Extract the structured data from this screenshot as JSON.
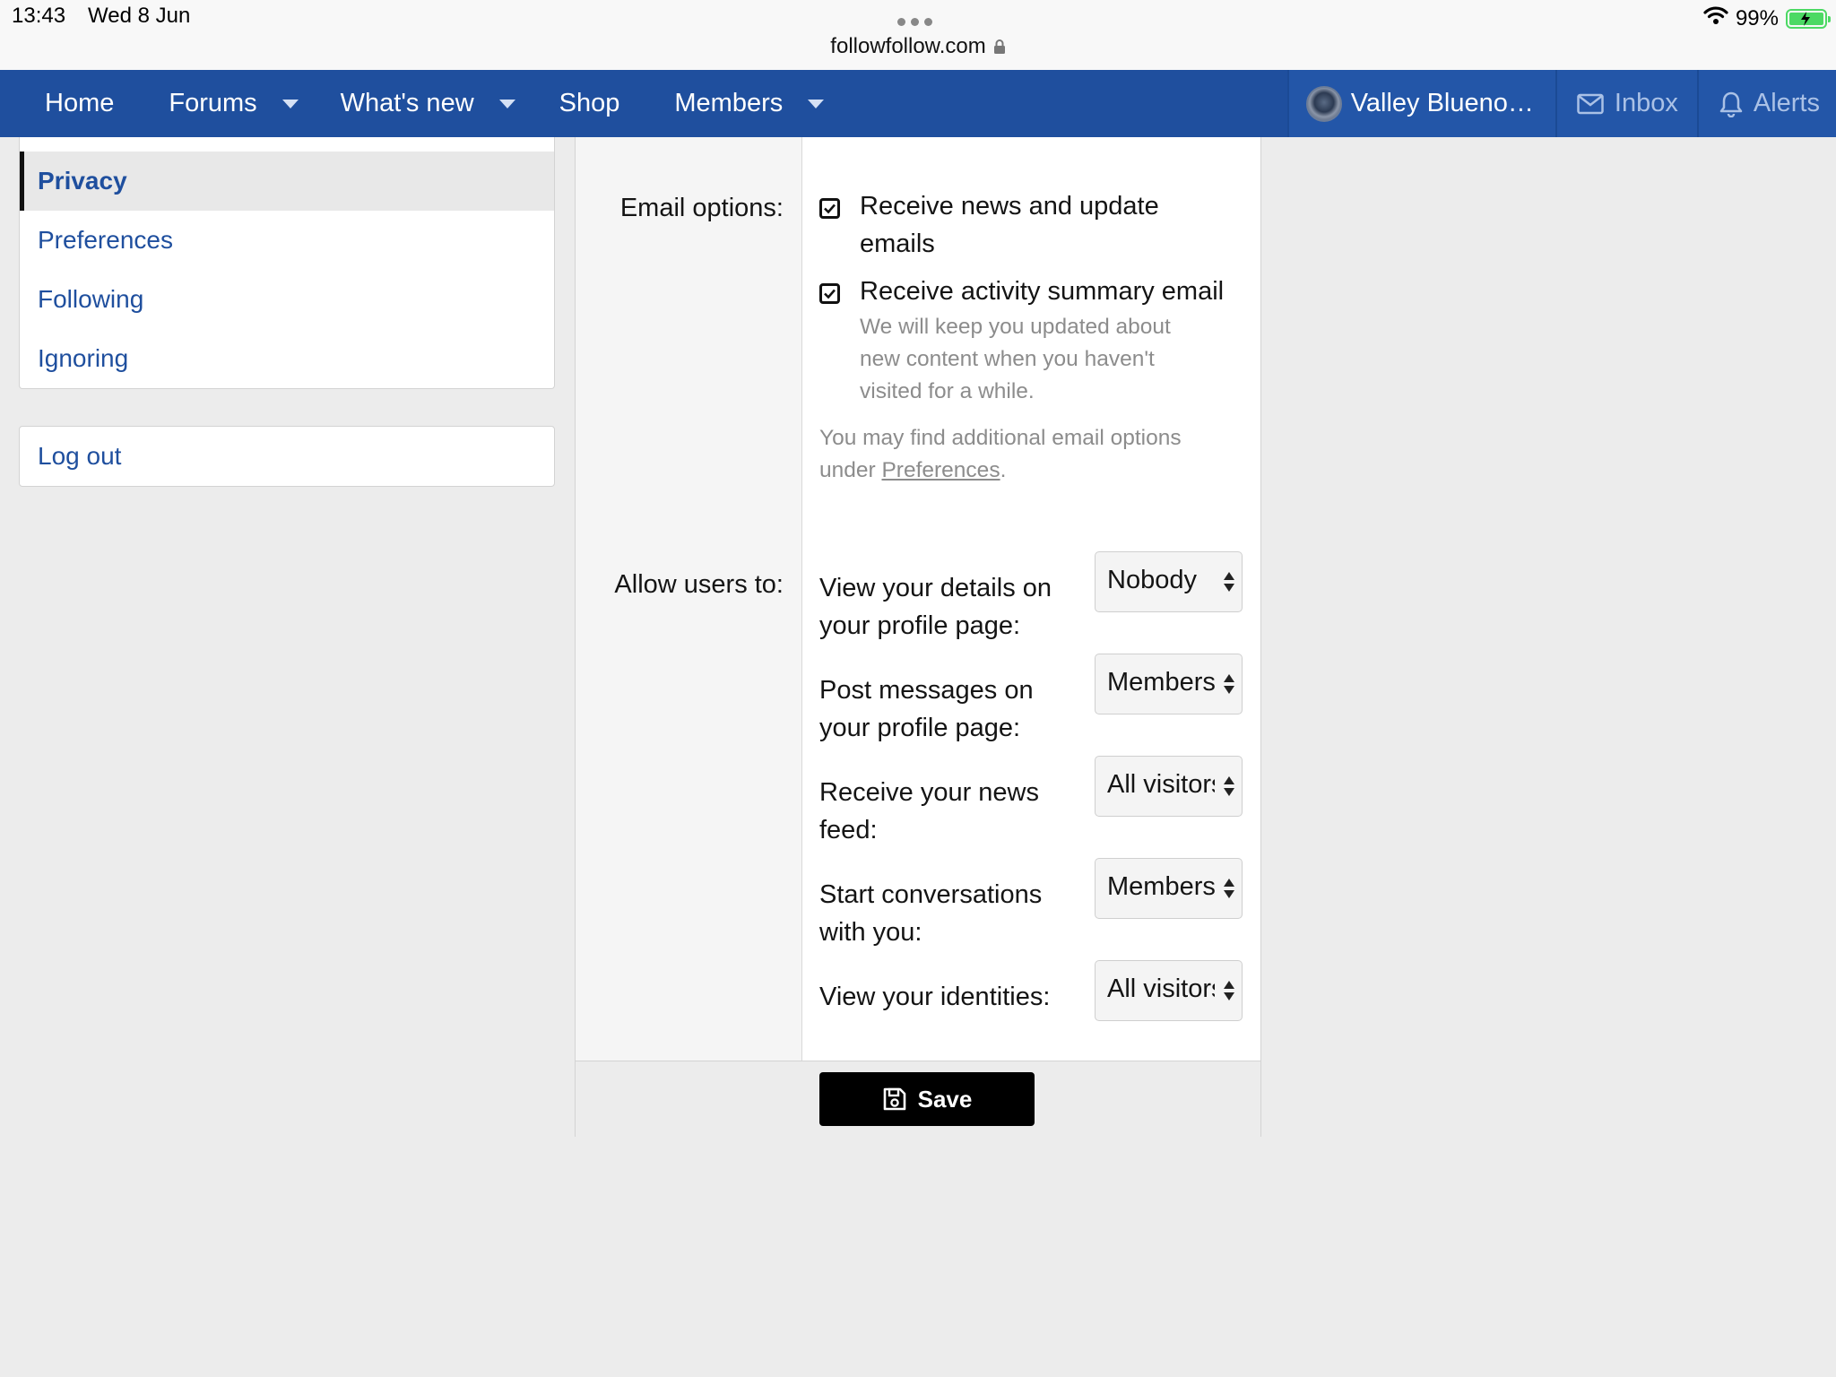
{
  "status_bar": {
    "time": "13:43",
    "date": "Wed 8 Jun",
    "url": "followfollow.com",
    "battery": "99%"
  },
  "nav": {
    "items": [
      {
        "label": "Home",
        "dropdown": false
      },
      {
        "label": "Forums",
        "dropdown": true
      },
      {
        "label": "What's new",
        "dropdown": true
      },
      {
        "label": "Shop",
        "dropdown": false
      },
      {
        "label": "Members",
        "dropdown": true
      }
    ],
    "user": "Valley Blueno…",
    "inbox": "Inbox",
    "alerts": "Alerts"
  },
  "sidebar": {
    "items": [
      "Privacy",
      "Preferences",
      "Following",
      "Ignoring"
    ],
    "active": "Privacy",
    "logout": "Log out"
  },
  "form": {
    "email_label": "Email options:",
    "email_options": [
      {
        "line1": "Receive news and update",
        "line2": "emails",
        "checked": true
      },
      {
        "line1": "Receive activity summary email",
        "checked": true,
        "hint": [
          "We will keep you updated about",
          "new content when you haven't",
          "visited for a while."
        ]
      }
    ],
    "email_note_line1": "You may find additional email options",
    "email_note_prefix": "under ",
    "email_note_link": "Preferences",
    "email_note_suffix": ".",
    "allow_label": "Allow users to:",
    "permissions": [
      {
        "line1": "View your details on",
        "line2": "your profile page:",
        "value": "Nobody"
      },
      {
        "line1": "Post messages on",
        "line2": "your profile page:",
        "value": "Members"
      },
      {
        "line1": "Receive your news",
        "line2": "feed:",
        "value": "All visitors"
      },
      {
        "line1": "Start conversations",
        "line2": "with you:",
        "value": "Members"
      },
      {
        "line1": "View your identities:",
        "line2": "",
        "value": "All visitors"
      }
    ],
    "save_label": "Save"
  }
}
